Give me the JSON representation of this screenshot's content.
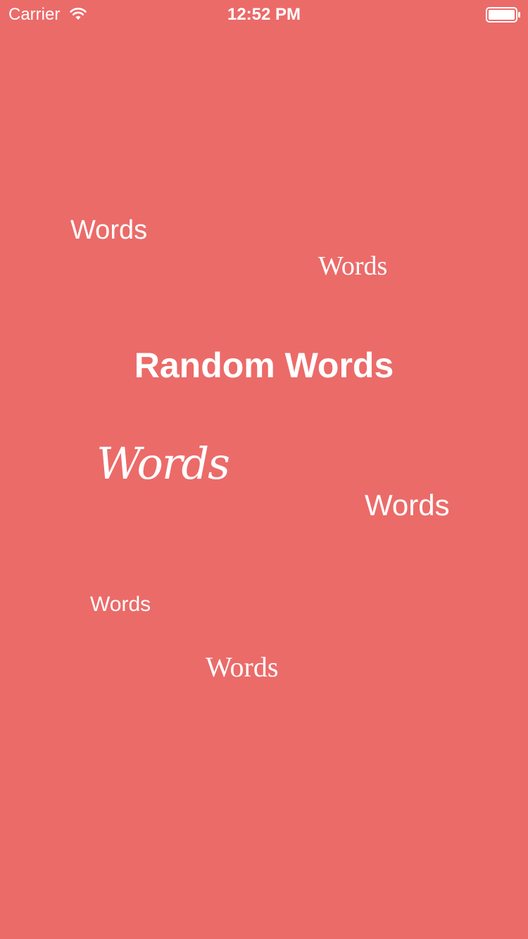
{
  "status_bar": {
    "carrier": "Carrier",
    "time": "12:52 PM",
    "icons": {
      "wifi": "wifi-icon",
      "battery": "battery-icon"
    }
  },
  "main": {
    "title": "Random Words",
    "words": [
      "Words",
      "Words",
      "Words",
      "Words",
      "Words",
      "Words"
    ]
  },
  "colors": {
    "background": "#EB6B69",
    "text": "#FFFFFF"
  }
}
